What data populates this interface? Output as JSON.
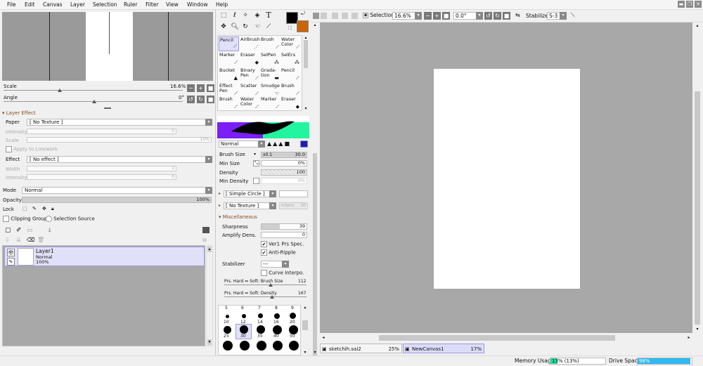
{
  "menu": [
    "File",
    "Edit",
    "Canvas",
    "Layer",
    "Selection",
    "Ruler",
    "Filter",
    "View",
    "Window",
    "Help"
  ],
  "window_controls": [
    "▬",
    "❐",
    "✕"
  ],
  "navigator": {
    "scale_label": "Scale",
    "scale_value": "16.6%",
    "angle_label": "Angle",
    "angle_value": "0°"
  },
  "layer_effect": {
    "header": "Layer Effect",
    "paper_label": "Paper",
    "paper_value": "[ No Texture ]",
    "intensity_label": "Intensity",
    "intensity_value": "0",
    "scale_label": "Scale",
    "scale_value": "10%",
    "apply_linework": "Apply to Linework",
    "effect_label": "Effect",
    "effect_value": "[ No effect ]",
    "width_label": "Width",
    "width_value": "1",
    "intensity2_label": "Intensity",
    "intensity2_value": "0"
  },
  "layer_props": {
    "mode_label": "Mode",
    "mode_value": "Normal",
    "opacity_label": "Opacity",
    "opacity_value": "100%",
    "lock_label": "Lock",
    "clipping_group": "Clipping Group",
    "selection_source": "Selection Source"
  },
  "layer": {
    "name": "Layer1",
    "mode": "Normal",
    "opacity": "100%"
  },
  "tools": {
    "brushes": [
      [
        "Pencil",
        "AirBrush",
        "Brush",
        "Water Color"
      ],
      [
        "Marker",
        "Eraser",
        "SelPen",
        "SelErs"
      ],
      [
        "Bucket",
        "Binary Pen",
        "Grada-tion",
        "Pencil"
      ],
      [
        "Effect Pen",
        "Scatter",
        "Smudge",
        "Brush"
      ],
      [
        "Brush",
        "Water Color",
        "Marker",
        "Eraser"
      ]
    ],
    "text_tool": "T"
  },
  "brush_settings": {
    "blend_mode": "Normal",
    "brush_size_label": "Brush Size",
    "brush_size_mult": "x0.1",
    "brush_size_value": "30.0",
    "min_size_label": "Min Size",
    "min_size_value": "0%",
    "density_label": "Density",
    "density_value": "100",
    "min_density_label": "Min Density",
    "min_density_value": "0%",
    "shape": "[ Simple Circle ]",
    "texture": "[ No Texture ]",
    "texture_intensity": "Intens",
    "texture_intensity_value": "30",
    "misc_header": "Miscellaneous",
    "sharpness_label": "Sharpness",
    "sharpness_value": "39",
    "amplify_label": "Amplify Dens.",
    "amplify_value": "0",
    "ver1_label": "Ver1 Prs Spec.",
    "antiripple_label": "Anti-Ripple",
    "stabilizer_label": "Stabilizer",
    "stabilizer_value": "---",
    "curve_label": "Curve Interpo.",
    "prs_size_label": "Prs. Hard ⇔ Soft: Brush Size",
    "prs_size_value": "112",
    "prs_density_label": "Prs. Hard ⇔ Soft: Density",
    "prs_density_value": "167"
  },
  "brush_sizes": [
    "5",
    "6",
    "7",
    "8",
    "9",
    "10",
    "12",
    "14",
    "16",
    "20",
    "25",
    "30",
    "35",
    "40",
    "50"
  ],
  "toolbar": {
    "selection_label": "Selection",
    "zoom_value": "16.6%",
    "rotation_value": "0.0°",
    "stabilizer_label": "Stabilizer",
    "stabilizer_value": "S-3"
  },
  "tabs": [
    {
      "name": "sketchih.sai2",
      "zoom": "25%"
    },
    {
      "name": "NewCanvas1",
      "zoom": "17%"
    }
  ],
  "status": {
    "memory_label": "Memory Usage",
    "memory_value": "13% (13%)",
    "drive_label": "Drive Space",
    "drive_value": "98%",
    "memory_percent": 13,
    "drive_percent": 98
  },
  "colors": {
    "primary": "#000000",
    "secondary": "#c8640a",
    "accent_purple": "#7a1ff5",
    "accent_green": "#22f5a0",
    "selection_blue": "#1aaaf0"
  }
}
